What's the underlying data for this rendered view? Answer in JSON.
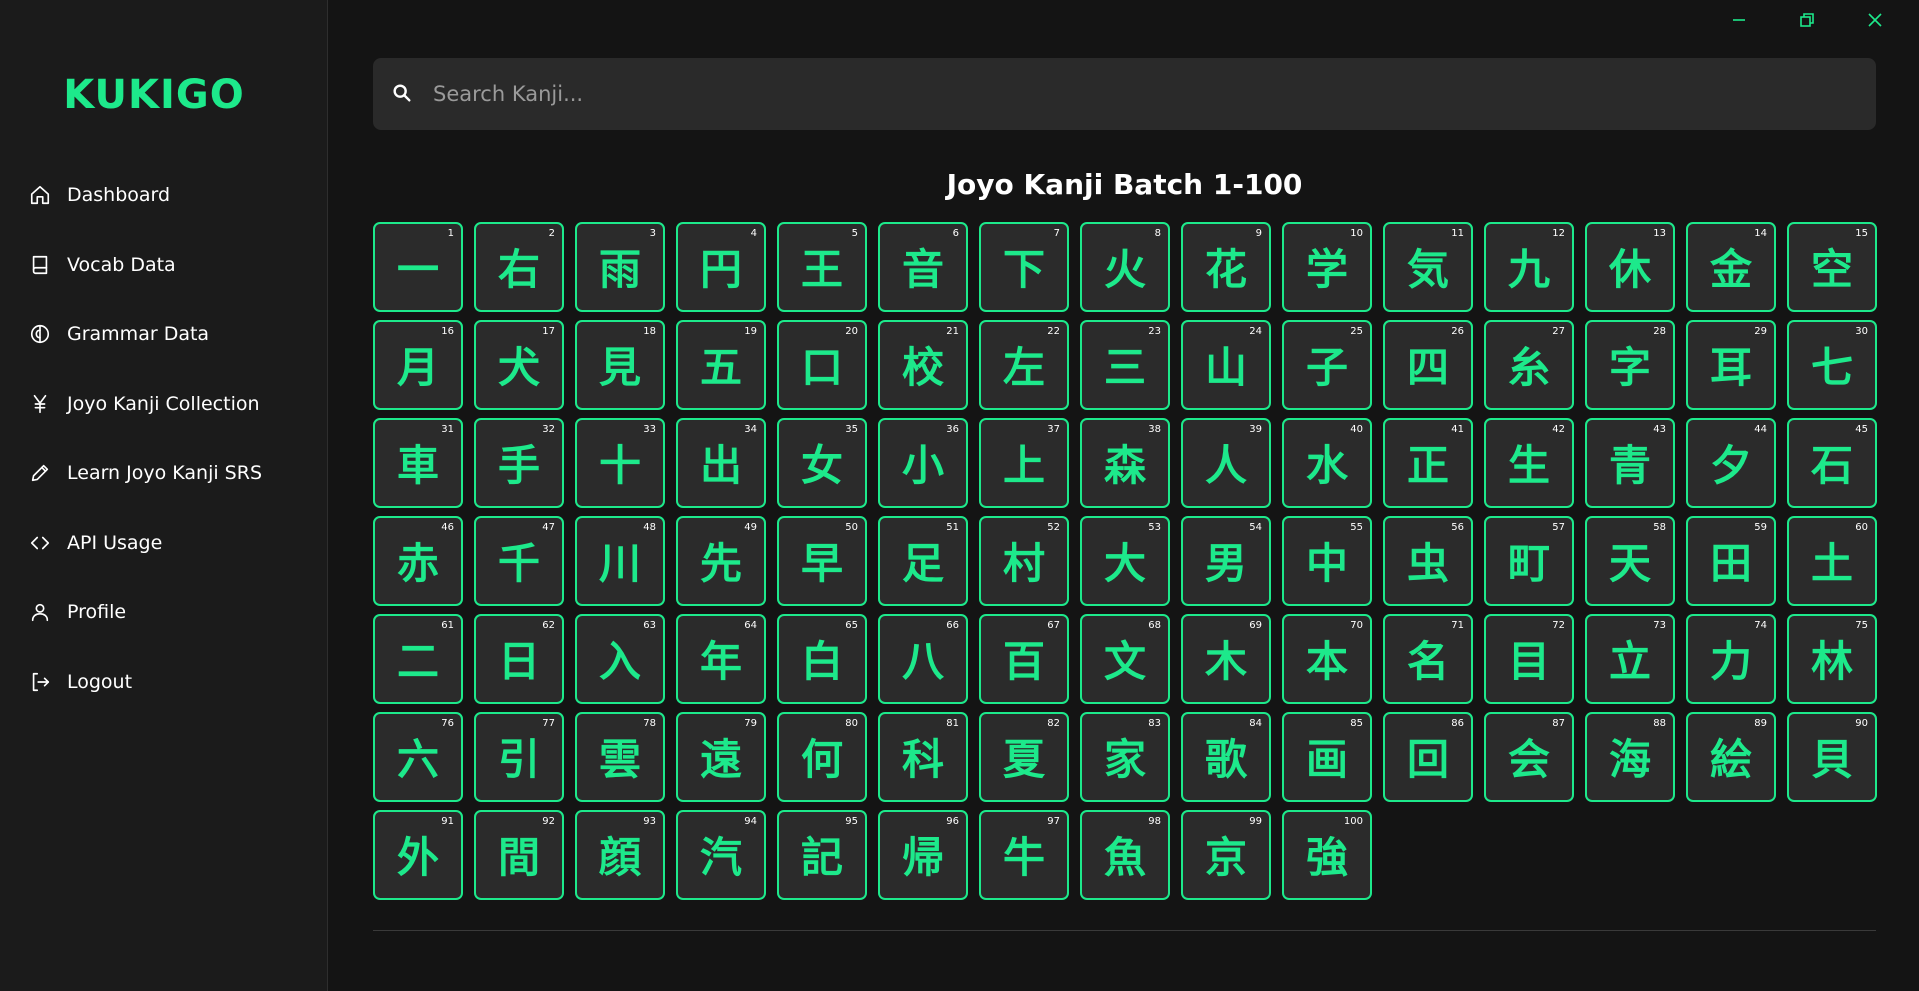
{
  "app": {
    "logo": "KUKIGO",
    "accent": "#1de98b"
  },
  "sidebar": {
    "items": [
      {
        "label": "Dashboard",
        "icon": "home-icon"
      },
      {
        "label": "Vocab Data",
        "icon": "book-icon"
      },
      {
        "label": "Grammar Data",
        "icon": "brain-icon"
      },
      {
        "label": "Joyo Kanji Collection",
        "icon": "yen-icon"
      },
      {
        "label": "Learn Joyo Kanji SRS",
        "icon": "pencil-icon"
      },
      {
        "label": "API Usage",
        "icon": "code-icon"
      },
      {
        "label": "Profile",
        "icon": "user-icon"
      },
      {
        "label": "Logout",
        "icon": "logout-icon"
      }
    ]
  },
  "search": {
    "placeholder": "Search Kanji..."
  },
  "batch": {
    "title": "Joyo Kanji Batch 1-100",
    "kanji": [
      "一",
      "右",
      "雨",
      "円",
      "王",
      "音",
      "下",
      "火",
      "花",
      "学",
      "気",
      "九",
      "休",
      "金",
      "空",
      "月",
      "犬",
      "見",
      "五",
      "口",
      "校",
      "左",
      "三",
      "山",
      "子",
      "四",
      "糸",
      "字",
      "耳",
      "七",
      "車",
      "手",
      "十",
      "出",
      "女",
      "小",
      "上",
      "森",
      "人",
      "水",
      "正",
      "生",
      "青",
      "夕",
      "石",
      "赤",
      "千",
      "川",
      "先",
      "早",
      "足",
      "村",
      "大",
      "男",
      "中",
      "虫",
      "町",
      "天",
      "田",
      "土",
      "二",
      "日",
      "入",
      "年",
      "白",
      "八",
      "百",
      "文",
      "木",
      "本",
      "名",
      "目",
      "立",
      "力",
      "林",
      "六",
      "引",
      "雲",
      "遠",
      "何",
      "科",
      "夏",
      "家",
      "歌",
      "画",
      "回",
      "会",
      "海",
      "絵",
      "貝",
      "外",
      "間",
      "顔",
      "汽",
      "記",
      "帰",
      "牛",
      "魚",
      "京",
      "強"
    ]
  }
}
